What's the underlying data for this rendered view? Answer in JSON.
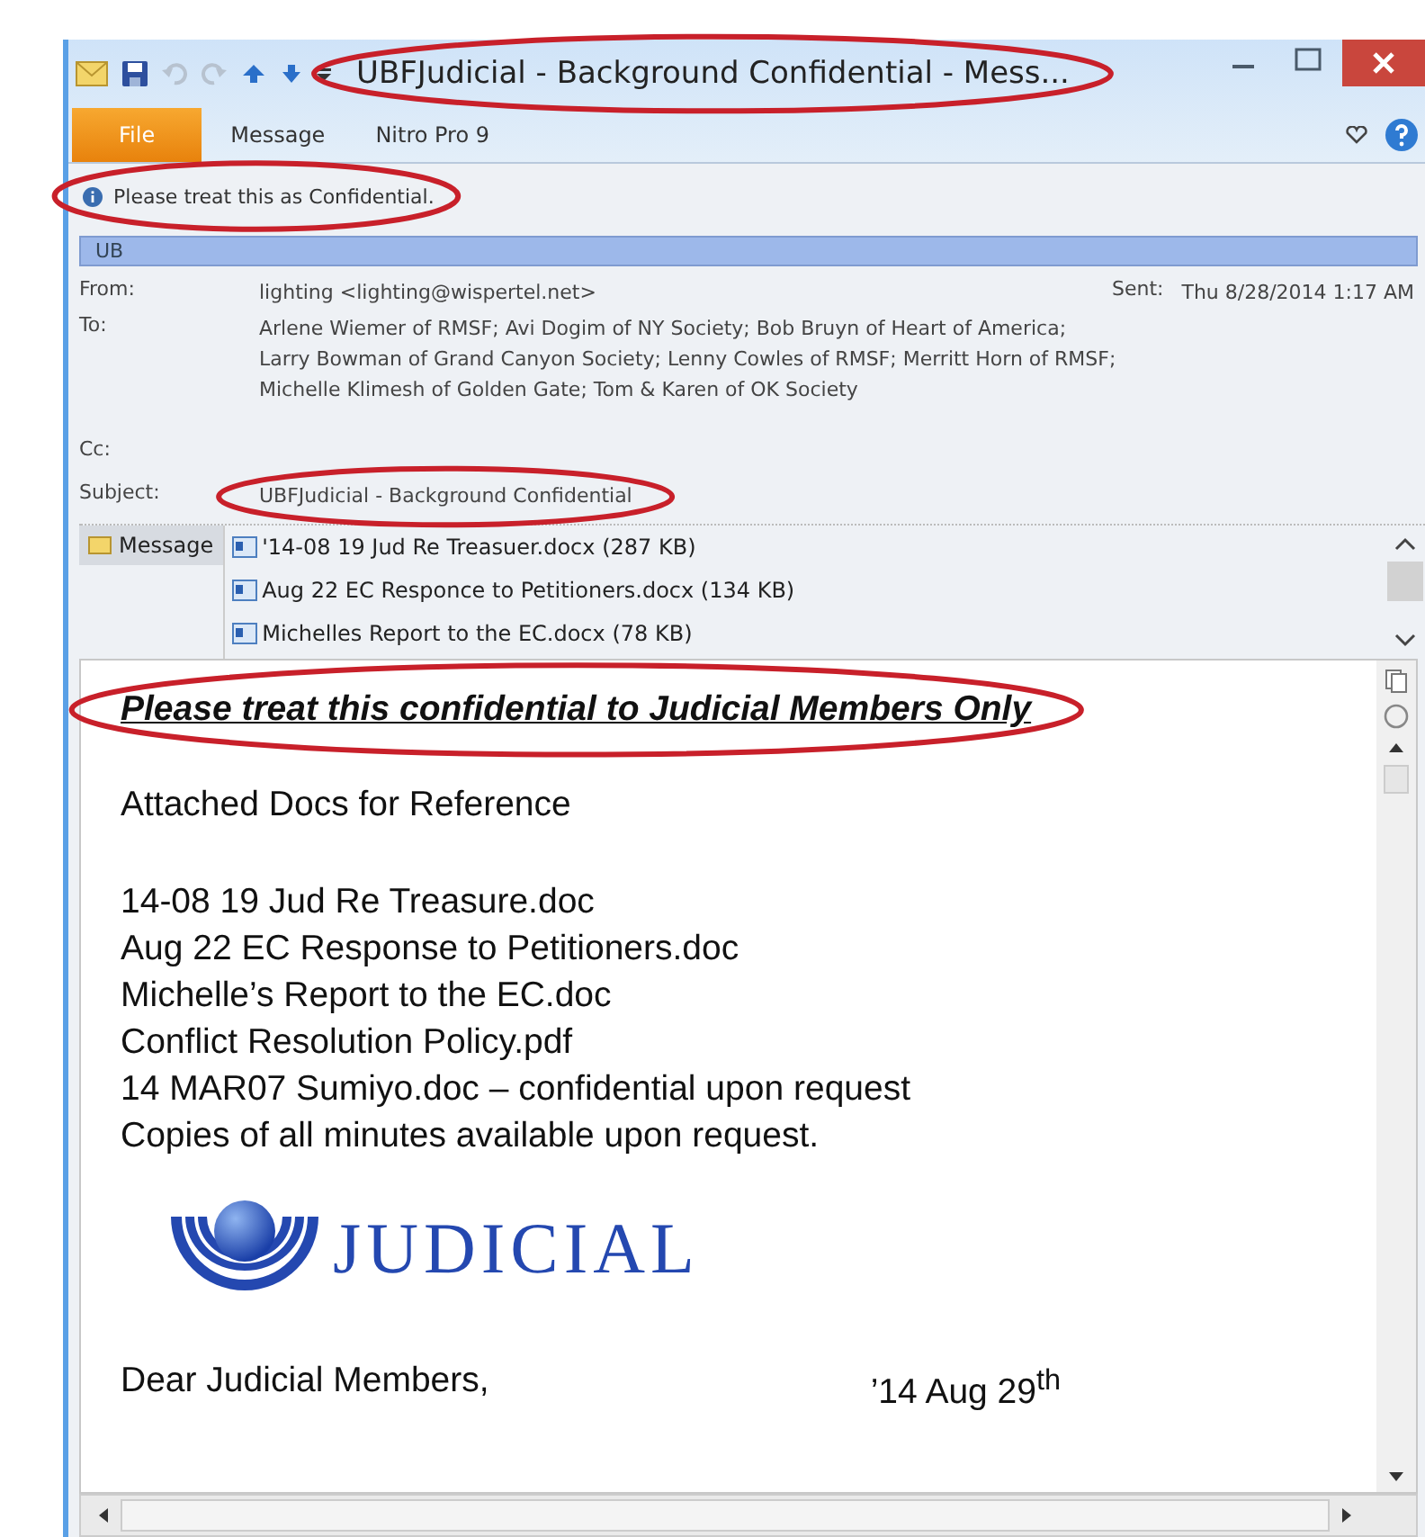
{
  "window": {
    "title": "UBFJudicial - Background Confidential - Mess..."
  },
  "ribbon_tabs": [
    {
      "label": "File",
      "kind": "file"
    },
    {
      "label": "Message",
      "kind": "tab"
    },
    {
      "label": "Nitro Pro 9",
      "kind": "tab"
    }
  ],
  "info_bar": {
    "text": "Please treat this as Confidential."
  },
  "people_bar": {
    "text": "UB"
  },
  "header": {
    "from_label": "From:",
    "from": "lighting <lighting@wispertel.net>",
    "sent_label": "Sent:",
    "sent": "Thu 8/28/2014 1:17 AM",
    "to_label": "To:",
    "to_lines": [
      "Arlene Wiemer of RMSF; Avi Dogim of NY Society; Bob Bruyn of Heart of America;",
      "Larry Bowman of Grand Canyon Society; Lenny Cowles of RMSF; Merritt Horn of RMSF;",
      "Michelle Klimesh of Golden Gate; Tom & Karen of OK Society"
    ],
    "cc_label": "Cc:",
    "subject_label": "Subject:",
    "subject": "UBFJudicial - Background Confidential"
  },
  "attachments": {
    "tab_label": "Message",
    "files": [
      "'14-08 19 Jud Re Treasuer.docx (287 KB)",
      "Aug 22 EC Responce to Petitioners.docx (134 KB)",
      "Michelles Report to the EC.docx (78 KB)"
    ]
  },
  "body": {
    "heading": "Please treat this confidential to Judicial Members Only",
    "intro": "Attached Docs for Reference",
    "lines": [
      "14-08 19 Jud Re Treasure.doc",
      "Aug 22 EC Response to Petitioners.doc",
      "Michelle’s Report to the EC.doc",
      "Conflict Resolution Policy.pdf",
      "14 MAR07 Sumiyo.doc – confidential upon request",
      "Copies of all minutes available upon request."
    ],
    "logo_text": "JUDICIAL",
    "greeting": "Dear Judicial Members,",
    "date": "’14 Aug 29$^{th}$"
  }
}
